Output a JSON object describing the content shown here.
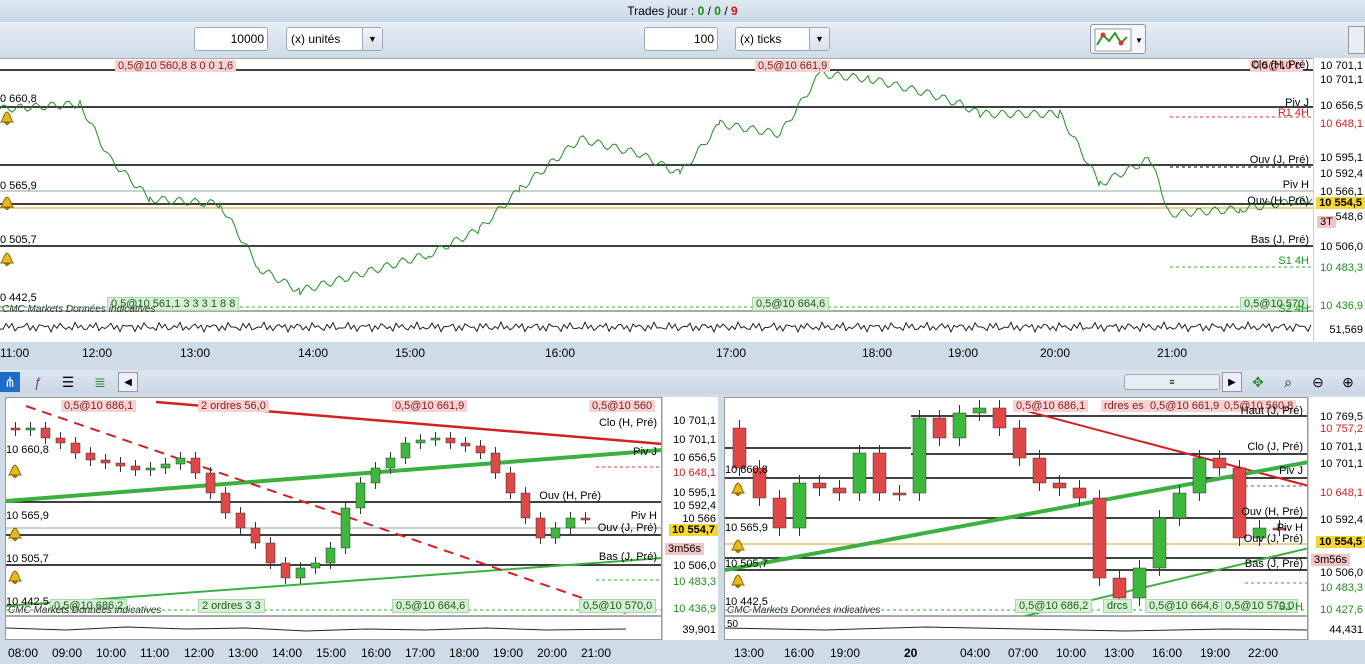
{
  "header": {
    "trades_label": "Trades jour :",
    "t1": "0",
    "sep1": "/",
    "t2": "0",
    "sep2": "/",
    "t3": "9"
  },
  "toolbar": {
    "qty_value": "10000",
    "qty_unit": "(x) unités",
    "ticks_value": "100",
    "ticks_unit": "(x) ticks"
  },
  "top_chart": {
    "left_levels": [
      "0 660,8",
      "0 565,9",
      "0 505,7",
      "0 442,5"
    ],
    "line_labels": [
      "Clo (H, Pré)",
      "Piv J",
      "R1 4H",
      "Ouv (J, Pré)",
      "Piv H",
      "Ouv (H, Pré)",
      "Bas (J, Pré)",
      "S1 4H",
      "S2 4H"
    ],
    "pink_boxes": [
      "0,5@10 560,8 8 0 0 1,6",
      "0,5@10 661,9",
      "0,5@10 c"
    ],
    "green_boxes": [
      "0,5@10 561,1 3 3 3 1 8 8",
      "0,5@10 664,6",
      "0,5@10 570"
    ],
    "footer": "CMC Markets Données indicatives",
    "axis": [
      "10 701,1",
      "10 701,1",
      "10 656,5",
      "10 648,1",
      "10 595,1",
      "10 592,4",
      "10 566,1",
      "10 554,5",
      "548,6",
      "10 506,0",
      "10 483,3",
      "10 436,9",
      "51,569"
    ],
    "current_price": "10 554,5",
    "badge": "3T",
    "times": [
      "11:00",
      "12:00",
      "13:00",
      "14:00",
      "15:00",
      "16:00",
      "17:00",
      "18:00",
      "19:00",
      "20:00",
      "21:00"
    ]
  },
  "bottom_left": {
    "pink_boxes": [
      "0,5@10 686,1",
      "2 ordres 56,0",
      "0,5@10 661,9",
      "0,5@10 560"
    ],
    "green_boxes": [
      "0,5@10 686,2",
      "2 ordres 3 3",
      "0,5@10 664,6",
      "0,5@10 570,0"
    ],
    "left_levels": [
      "10 660,8",
      "10 565,9",
      "10 505,7",
      "10 442,5"
    ],
    "line_labels": [
      "Clo (H, Pré)",
      "Piv J",
      "Ouv (H, Pré)",
      "Piv H",
      "Ouv (J, Pré)",
      "Bas (J, Pré)"
    ],
    "axis": [
      "10 701,1",
      "10 701,1",
      "10 656,5",
      "10 648,1",
      "10 595,1",
      "10 592,4",
      "10 566",
      "10 554,7",
      "10 506,0",
      "10 483,3",
      "10 436,9",
      "39,901"
    ],
    "current_price": "10 554,7",
    "timer": "3m56s",
    "footer": "CMC Markets Données indicatives",
    "times": [
      "08:00",
      "09:00",
      "10:00",
      "11:00",
      "12:00",
      "13:00",
      "14:00",
      "15:00",
      "16:00",
      "17:00",
      "18:00",
      "19:00",
      "20:00",
      "21:00"
    ]
  },
  "bottom_right": {
    "pink_boxes": [
      "0,5@10 686,1",
      "rdres es",
      "0,5@10 661,9",
      "0,5@10 560,8"
    ],
    "green_boxes": [
      "0,5@10 686,2",
      "drcs",
      "0,5@10 664,6",
      "0,5@10 570,0"
    ],
    "left_levels": [
      "10 660,8",
      "10 565,9",
      "10 505,7",
      "10 442,5"
    ],
    "line_labels": [
      "Haut (J, Pré)",
      "Clo (J, Pré)",
      "Piv J",
      "Ouv (H, Pré)",
      "Piv H",
      "Ouv (J, Pré)",
      "Bas (J, Pré)",
      "S1 H"
    ],
    "axis": [
      "10 769,5",
      "10 757,2",
      "10 701,1",
      "10 701,1",
      "10 648,1",
      "10 592,4",
      "10 554,5",
      "10 506,0",
      "10 483,3",
      "10 427,6",
      "44,431"
    ],
    "current_price": "10 554,5",
    "timer": "3m56s",
    "footer": "CMC Markets Données indicatives",
    "osc_val": "50",
    "times": [
      "13:00",
      "16:00",
      "19:00",
      "20",
      "04:00",
      "07:00",
      "10:00",
      "13:00",
      "16:00",
      "19:00",
      "22:00"
    ]
  },
  "colors": {
    "bull": "#3cb83c",
    "bear": "#e04848",
    "trend_red": "#d42020",
    "trend_green": "#3cb040",
    "price_badge": "#f6d632"
  }
}
